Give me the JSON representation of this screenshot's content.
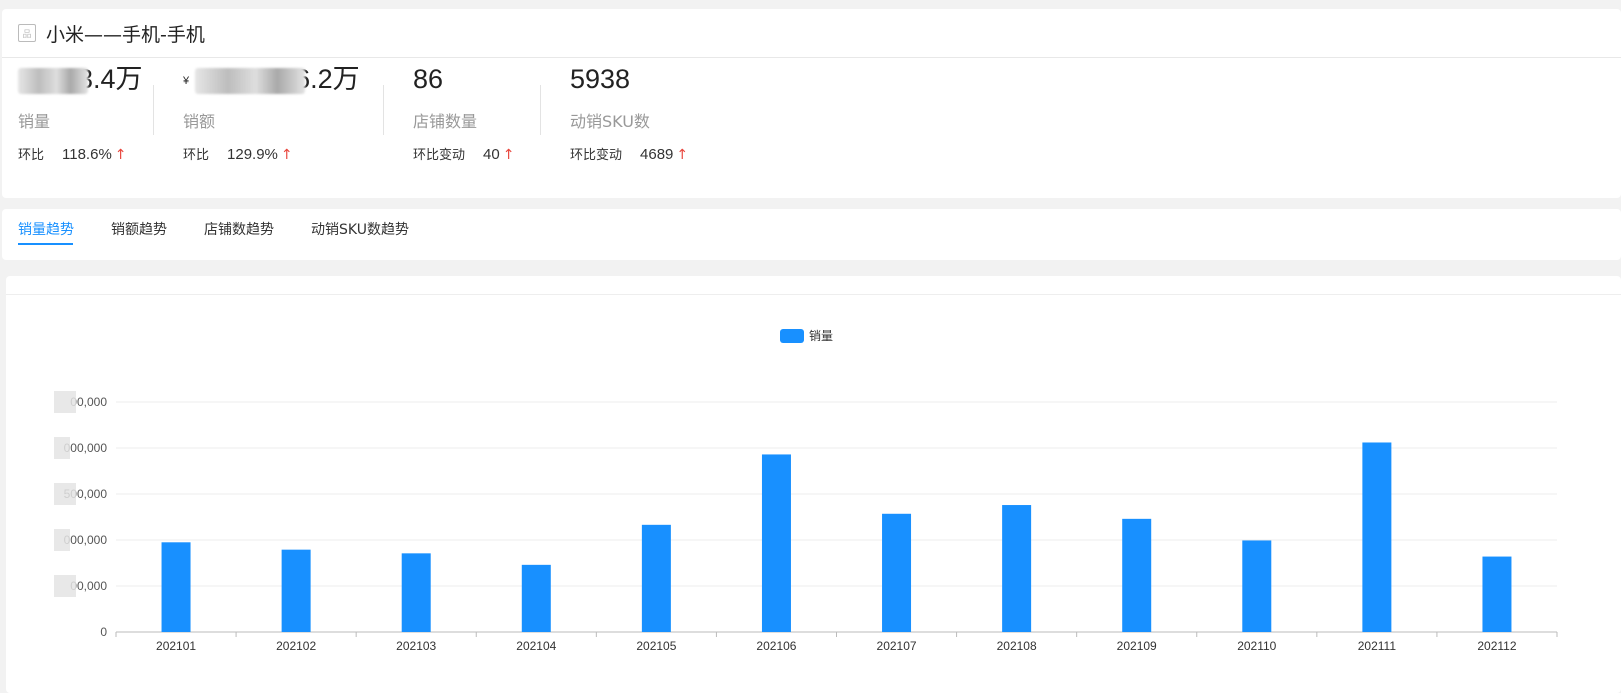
{
  "header": {
    "title": "小米——手机-手机"
  },
  "metrics": [
    {
      "value": "3.4万",
      "label": "销量",
      "change_label": "环比",
      "change_value": "118.6%"
    },
    {
      "currency": "¥",
      "value": "6.2万",
      "label": "销额",
      "change_label": "环比",
      "change_value": "129.9%"
    },
    {
      "value": "86",
      "label": "店铺数量",
      "change_label": "环比变动",
      "change_value": "40"
    },
    {
      "value": "5938",
      "label": "动销SKU数",
      "change_label": "环比变动",
      "change_value": "4689"
    }
  ],
  "tabs": [
    {
      "label": "销量趋势",
      "active": true
    },
    {
      "label": "销额趋势",
      "active": false
    },
    {
      "label": "店铺数趋势",
      "active": false
    },
    {
      "label": "动销SKU数趋势",
      "active": false
    }
  ],
  "colors": {
    "accent": "#1890ff",
    "up_arrow": "#e8453c"
  },
  "icons": {
    "title_icon": "product-icon",
    "change_arrow": "arrow-up-icon"
  },
  "chart_data": {
    "type": "bar",
    "legend": "销量",
    "legend_position": "top-center",
    "grid": true,
    "categories": [
      "202101",
      "202102",
      "202103",
      "202104",
      "202105",
      "202106",
      "202107",
      "202108",
      "202109",
      "202110",
      "202111",
      "202112"
    ],
    "series": [
      {
        "name": "销量",
        "values": [
          975000,
          895000,
          855000,
          730000,
          1165000,
          1930000,
          1285000,
          1380000,
          1230000,
          995000,
          2060000,
          820000
        ]
      }
    ],
    "y_ticks": [
      "0",
      "00,000",
      "000,000",
      "500,000",
      "000,000",
      "00,000"
    ],
    "ylim": [
      0,
      2500000
    ]
  }
}
